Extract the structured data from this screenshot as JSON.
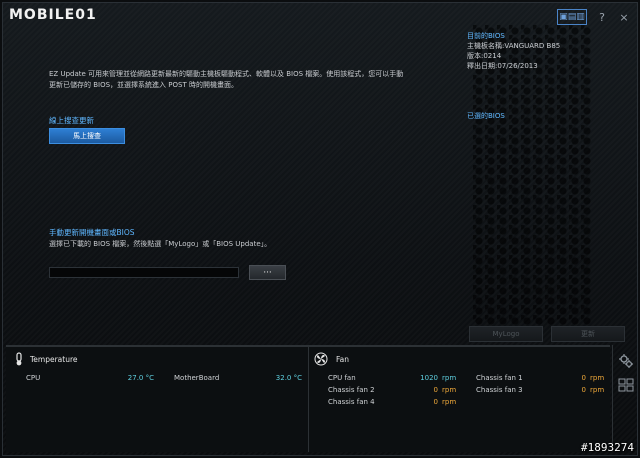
{
  "branding": {
    "logo_text": "MOBILE01"
  },
  "title_controls": {
    "layout_toggle": "▣▤▥",
    "help": "?",
    "close": "×"
  },
  "intro_text": "EZ Update 可用來管理並從網路更新最新的驅動主機板驅動程式、軟體以及 BIOS 檔案。使用該程式，您可以手動更新已儲存的 BIOS，並選擇系統進入 POST 時的開機畫面。",
  "online_update": {
    "title": "線上搜查更新",
    "button_label": "馬上搜查"
  },
  "manual_update": {
    "title": "手動更新開機畫面或BIOS",
    "instruction": "選擇已下載的 BIOS 檔案，然後點選「MyLogo」或「BIOS Update」。",
    "file_value": "",
    "browse_label": "···"
  },
  "current_bios": {
    "header": "目前的BIOS",
    "board": "主機板名稱:VANGUARD B85",
    "version": "版本:0214",
    "date": "釋出日期:07/26/2013"
  },
  "selected_bios": {
    "header": "已選的BIOS"
  },
  "actions": {
    "mylogo": "MyLogo",
    "update": "更新"
  },
  "temperature": {
    "title": "Temperature",
    "rows": [
      {
        "label": "CPU",
        "value": "27.0 °C"
      },
      {
        "label": "MotherBoard",
        "value": "32.0 °C"
      }
    ]
  },
  "fan": {
    "title": "Fan",
    "rows": [
      {
        "label": "CPU fan",
        "value": "1020",
        "unit": "rpm"
      },
      {
        "label": "Chassis fan 1",
        "value": "0",
        "unit": "rpm"
      },
      {
        "label": "Chassis fan 2",
        "value": "0",
        "unit": "rpm"
      },
      {
        "label": "Chassis fan 3",
        "value": "0",
        "unit": "rpm"
      },
      {
        "label": "Chassis fan 4",
        "value": "0",
        "unit": "rpm"
      }
    ]
  },
  "watermark": "#1893274",
  "colors": {
    "accent": "#5fb7ff",
    "primary_button": "#2e7fd4",
    "temp_value": "#5fd0e0",
    "fan_value": "#f0a93a"
  }
}
